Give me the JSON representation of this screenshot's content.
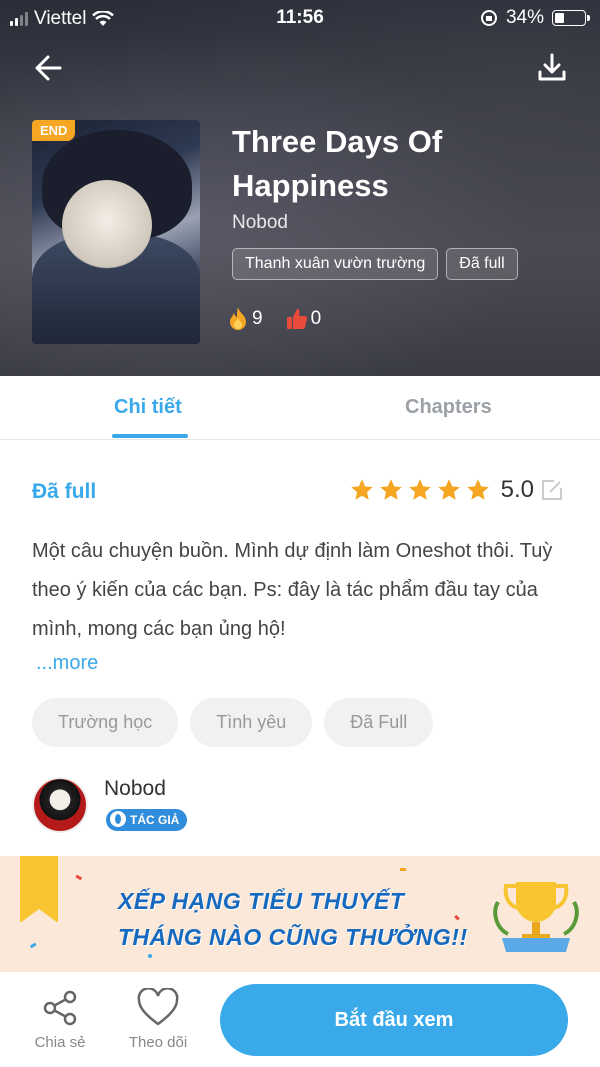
{
  "status_bar": {
    "carrier": "Viettel",
    "time": "11:56",
    "battery": "34%",
    "battery_level": 0.34
  },
  "header": {
    "back_icon": "arrow-left-icon",
    "download_icon": "download-icon"
  },
  "book": {
    "end_badge": "END",
    "title": "Three Days Of Happiness",
    "author": "Nobod",
    "tags": [
      "Thanh xuân vườn trường",
      "Đã full"
    ],
    "fire_count": "9",
    "like_count": "0"
  },
  "tabs": [
    {
      "label": "Chi tiết",
      "active": true
    },
    {
      "label": "Chapters",
      "active": false
    }
  ],
  "detail": {
    "status": "Đã full",
    "rating": "5.0",
    "stars": 5,
    "description": "Một câu chuyện buồn. Mình dự định làm Oneshot thôi. Tuỳ theo ý kiến của các bạn. Ps: đây là tác phẩm đầu tay của mình, mong các bạn ủng hộ!",
    "more": "...more",
    "genres": [
      "Trường học",
      "Tình yêu",
      "Đã Full"
    ]
  },
  "author_card": {
    "name": "Nobod",
    "badge": "TÁC GIẢ"
  },
  "banner": {
    "line1": "XẾP HẠNG TIỂU THUYẾT",
    "line2": "THÁNG NÀO CŨNG THƯỞNG!!"
  },
  "bottom_bar": {
    "share": "Chia sẻ",
    "follow": "Theo dõi",
    "start": "Bắt đầu xem"
  },
  "colors": {
    "accent": "#3aa9ea",
    "star": "#f5a623",
    "banner_text": "#1569bf"
  }
}
